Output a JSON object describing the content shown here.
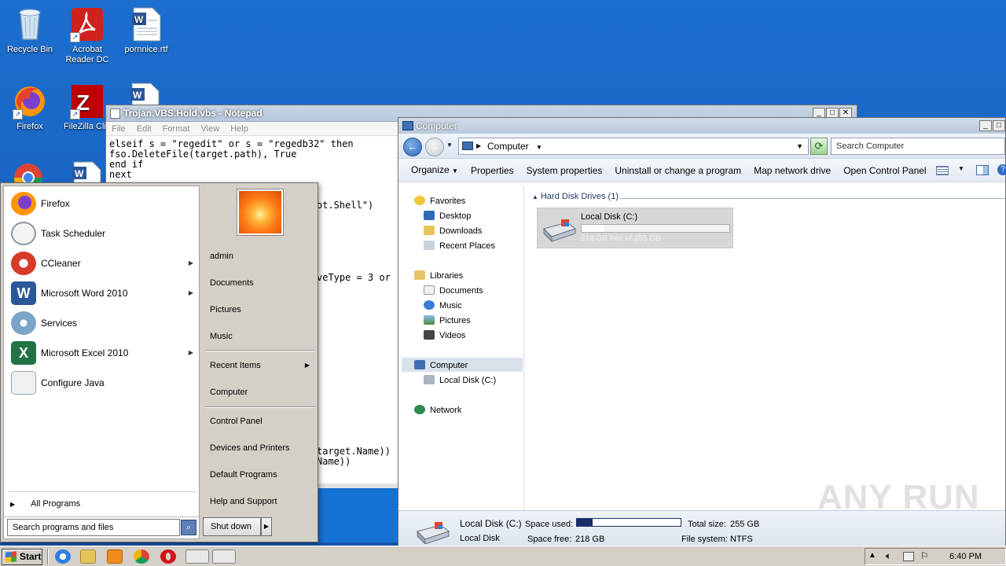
{
  "desktop": {
    "icons": [
      {
        "label": "Recycle Bin"
      },
      {
        "label": "Acrobat Reader DC"
      },
      {
        "label": "pornnice.rtf"
      },
      {
        "label": "Firefox"
      },
      {
        "label": "FileZilla Clie"
      }
    ]
  },
  "notepad": {
    "title": "Trojan.VBS.Hold.vbs - Notepad",
    "menu": [
      "File",
      "Edit",
      "Format",
      "View",
      "Help"
    ],
    "lines": [
      "elseif s = \"regedit\" or s = \"regedb32\" then",
      "fso.DeleteFile(target.path), True",
      "end if",
      "next"
    ],
    "fragments": [
      "ot.Shell\")",
      "veType = 3 or",
      "target.Name))",
      "Name))"
    ]
  },
  "explorer": {
    "title": "Computer",
    "address": "Computer",
    "search_placeholder": "Search Computer",
    "commands": [
      "Organize",
      "Properties",
      "System properties",
      "Uninstall or change a program",
      "Map network drive",
      "Open Control Panel"
    ],
    "nav": {
      "favorites": "Favorites",
      "desktop": "Desktop",
      "downloads": "Downloads",
      "recent_places": "Recent Places",
      "libraries": "Libraries",
      "documents": "Documents",
      "music": "Music",
      "pictures": "Pictures",
      "videos": "Videos",
      "computer": "Computer",
      "local_disk": "Local Disk (C:)",
      "network": "Network"
    },
    "group_header": "Hard Disk Drives (1)",
    "drive": {
      "name": "Local Disk (C:)",
      "free_text": "218 GB free of 255 GB",
      "used_fraction": 0.15
    },
    "details": {
      "name": "Local Disk (C:)",
      "type": "Local Disk",
      "space_used_label": "Space used:",
      "space_free_label": "Space free:",
      "space_free": "218 GB",
      "total_size_label": "Total size:",
      "total_size": "255 GB",
      "file_system_label": "File system:",
      "file_system": "NTFS",
      "used_fraction": 0.15
    }
  },
  "start_menu": {
    "programs": [
      {
        "label": "Firefox",
        "submenu": false,
        "color": "#e66000"
      },
      {
        "label": "Task Scheduler",
        "submenu": false,
        "color": "#bfc7cf"
      },
      {
        "label": "CCleaner",
        "submenu": true,
        "color": "#d83a2a"
      },
      {
        "label": "Microsoft Word 2010",
        "submenu": true,
        "color": "#2b579a"
      },
      {
        "label": "Services",
        "submenu": false,
        "color": "#7aa5c9"
      },
      {
        "label": "Microsoft Excel 2010",
        "submenu": true,
        "color": "#217346"
      },
      {
        "label": "Configure Java",
        "submenu": false,
        "color": "#e0e0e0"
      }
    ],
    "all_programs": "All Programs",
    "search_placeholder": "Search programs and files",
    "right": {
      "user": "admin",
      "documents": "Documents",
      "pictures": "Pictures",
      "music": "Music",
      "recent_items": "Recent Items",
      "computer": "Computer",
      "control_panel": "Control Panel",
      "devices_printers": "Devices and Printers",
      "default_programs": "Default Programs",
      "help_support": "Help and Support"
    },
    "shutdown": "Shut down"
  },
  "taskbar": {
    "start": "Start",
    "clock": "6:40 PM"
  },
  "watermark": "ANY RUN"
}
